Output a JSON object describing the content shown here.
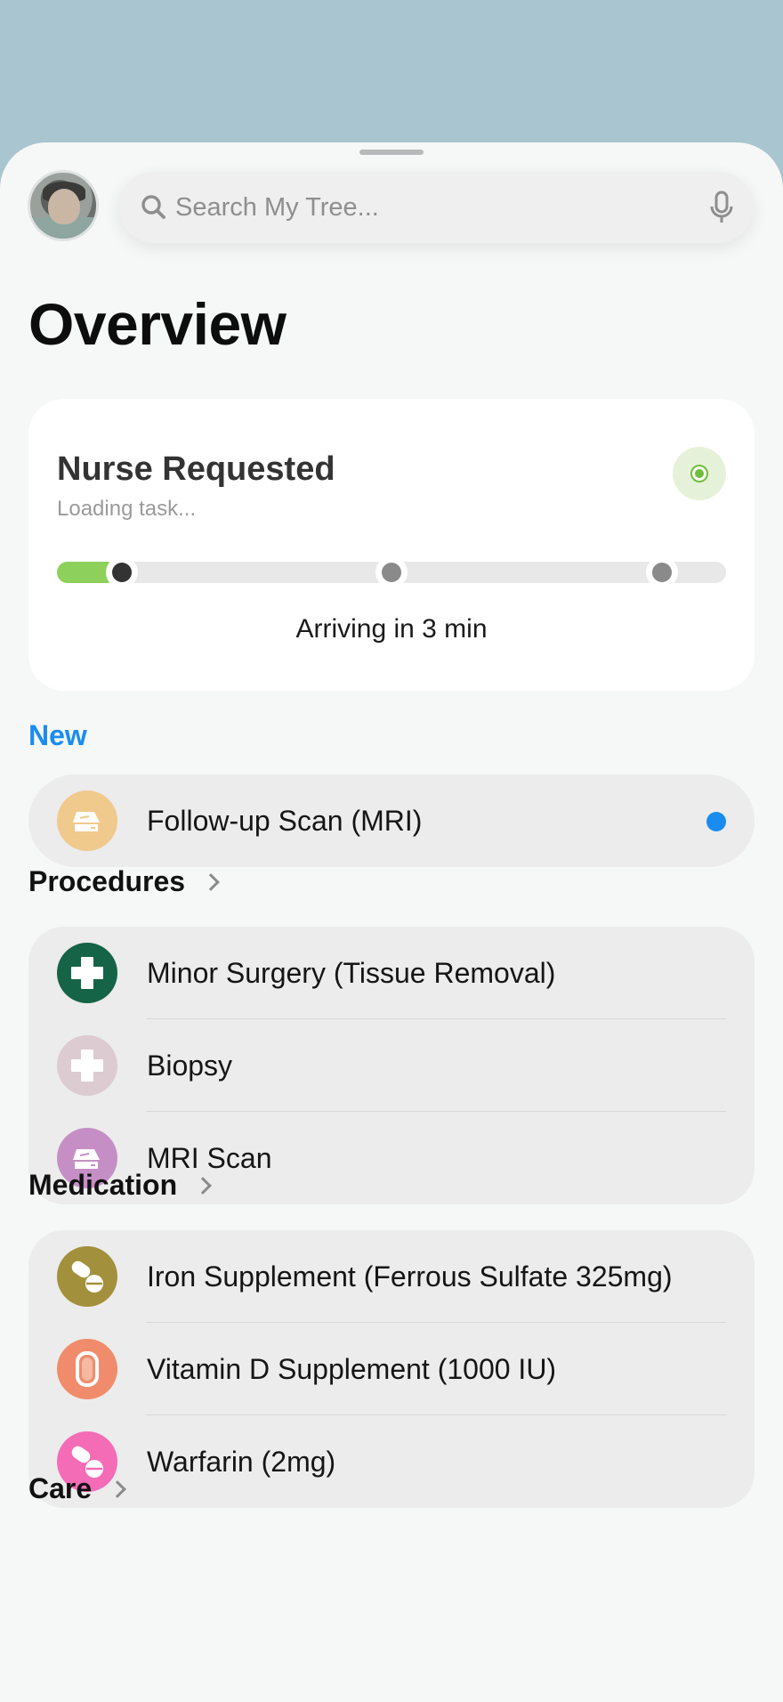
{
  "search": {
    "placeholder": "Search My Tree..."
  },
  "page_title": "Overview",
  "task": {
    "title": "Nurse Requested",
    "subtitle": "Loading task...",
    "eta": "Arriving in 3 min",
    "progress": 0.09,
    "status_color": "#6fbe3b"
  },
  "sections": {
    "new": {
      "label": "New",
      "items": [
        {
          "label": "Follow-up Scan (MRI)",
          "icon": "scanner-icon",
          "color": "#f0c98d",
          "unread": true
        }
      ]
    },
    "procedures": {
      "label": "Procedures",
      "items": [
        {
          "label": "Minor Surgery (Tissue Removal)",
          "icon": "medical-cross-icon",
          "color": "#166448"
        },
        {
          "label": "Biopsy",
          "icon": "medical-cross-icon",
          "color": "#dccbd0"
        },
        {
          "label": "MRI Scan",
          "icon": "scanner-icon",
          "color": "#c58fc6"
        }
      ]
    },
    "medication": {
      "label": "Medication",
      "items": [
        {
          "label": "Iron Supplement (Ferrous Sulfate 325mg)",
          "icon": "pills-icon",
          "color": "#a3903c"
        },
        {
          "label": "Vitamin D Supplement (1000 IU)",
          "icon": "capsule-icon",
          "color": "#f08c6c"
        },
        {
          "label": "Warfarin (2mg)",
          "icon": "pills-icon",
          "color": "#f46cb6"
        }
      ]
    },
    "care": {
      "label": "Care"
    }
  },
  "colors": {
    "accent_blue": "#1a8cf0",
    "progress_green": "#8dd05b"
  }
}
